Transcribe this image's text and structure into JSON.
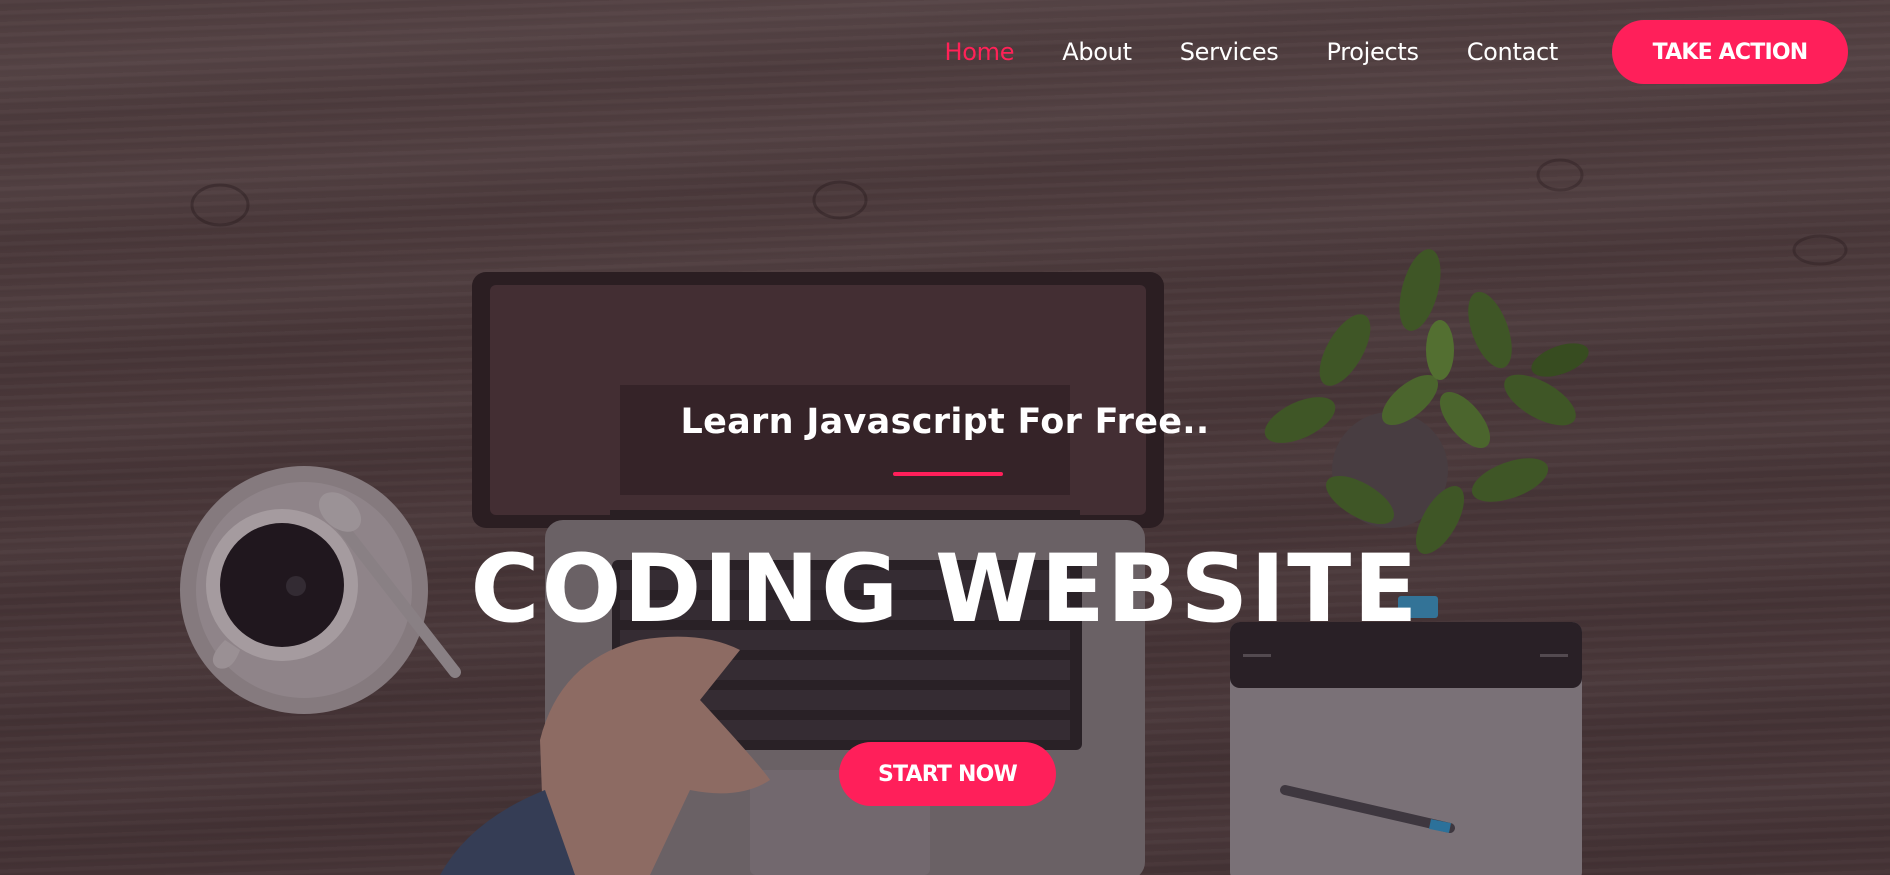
{
  "nav": {
    "links": [
      {
        "label": "Home",
        "active": true
      },
      {
        "label": "About",
        "active": false
      },
      {
        "label": "Services",
        "active": false
      },
      {
        "label": "Projects",
        "active": false
      },
      {
        "label": "Contact",
        "active": false
      }
    ],
    "cta_label": "TAKE ACTION"
  },
  "hero": {
    "subtitle": "Learn Javascript For Free..",
    "title": "CODING WEBSITE",
    "button_label": "START NOW"
  },
  "colors": {
    "accent": "#ff1f5a",
    "text": "#ffffff"
  }
}
